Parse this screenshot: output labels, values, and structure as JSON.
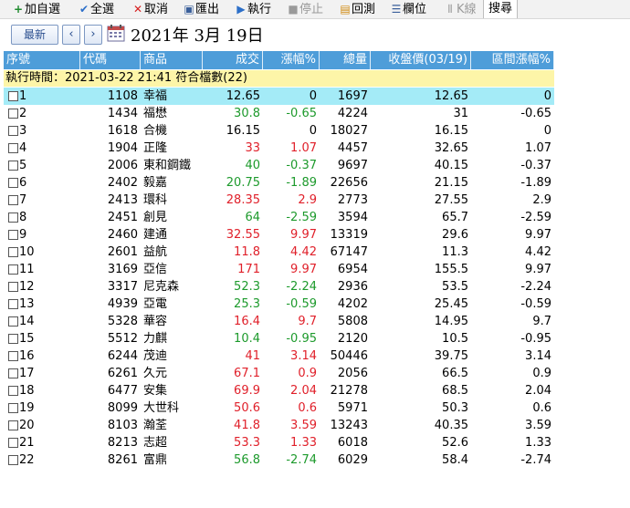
{
  "toolbar": {
    "add_watch": "加自選",
    "select_all": "全選",
    "cancel": "取消",
    "export": "匯出",
    "run": "執行",
    "stop": "停止",
    "backtest": "回測",
    "columns": "欄位",
    "kline": "K線",
    "search": "搜尋"
  },
  "daterow": {
    "latest": "最新",
    "date": "2021年  3月 19日"
  },
  "columns": [
    "序號",
    "代碼",
    "商品",
    "成交",
    "漲幅%",
    "總量",
    "收盤價(03/19)",
    "區間漲幅%"
  ],
  "info": "執行時間：2021-03-22 21:41 符合檔數(22)",
  "rows": [
    {
      "no": "1",
      "code": "1108",
      "name": "幸福",
      "price": "12.65",
      "chg": "0",
      "vol": "1697",
      "close": "12.65",
      "range": "0",
      "dir": "flat"
    },
    {
      "no": "2",
      "code": "1434",
      "name": "福懋",
      "price": "30.8",
      "chg": "-0.65",
      "vol": "4224",
      "close": "31",
      "range": "-0.65",
      "dir": "down"
    },
    {
      "no": "3",
      "code": "1618",
      "name": "合機",
      "price": "16.15",
      "chg": "0",
      "vol": "18027",
      "close": "16.15",
      "range": "0",
      "dir": "flat"
    },
    {
      "no": "4",
      "code": "1904",
      "name": "正隆",
      "price": "33",
      "chg": "1.07",
      "vol": "4457",
      "close": "32.65",
      "range": "1.07",
      "dir": "up"
    },
    {
      "no": "5",
      "code": "2006",
      "name": "東和鋼鐵",
      "price": "40",
      "chg": "-0.37",
      "vol": "9697",
      "close": "40.15",
      "range": "-0.37",
      "dir": "down"
    },
    {
      "no": "6",
      "code": "2402",
      "name": "毅嘉",
      "price": "20.75",
      "chg": "-1.89",
      "vol": "22656",
      "close": "21.15",
      "range": "-1.89",
      "dir": "down"
    },
    {
      "no": "7",
      "code": "2413",
      "name": "環科",
      "price": "28.35",
      "chg": "2.9",
      "vol": "2773",
      "close": "27.55",
      "range": "2.9",
      "dir": "up"
    },
    {
      "no": "8",
      "code": "2451",
      "name": "創見",
      "price": "64",
      "chg": "-2.59",
      "vol": "3594",
      "close": "65.7",
      "range": "-2.59",
      "dir": "down"
    },
    {
      "no": "9",
      "code": "2460",
      "name": "建通",
      "price": "32.55",
      "chg": "9.97",
      "vol": "13319",
      "close": "29.6",
      "range": "9.97",
      "dir": "up"
    },
    {
      "no": "10",
      "code": "2601",
      "name": "益航",
      "price": "11.8",
      "chg": "4.42",
      "vol": "67147",
      "close": "11.3",
      "range": "4.42",
      "dir": "up"
    },
    {
      "no": "11",
      "code": "3169",
      "name": "亞信",
      "price": "171",
      "chg": "9.97",
      "vol": "6954",
      "close": "155.5",
      "range": "9.97",
      "dir": "up"
    },
    {
      "no": "12",
      "code": "3317",
      "name": "尼克森",
      "price": "52.3",
      "chg": "-2.24",
      "vol": "2936",
      "close": "53.5",
      "range": "-2.24",
      "dir": "down"
    },
    {
      "no": "13",
      "code": "4939",
      "name": "亞電",
      "price": "25.3",
      "chg": "-0.59",
      "vol": "4202",
      "close": "25.45",
      "range": "-0.59",
      "dir": "down"
    },
    {
      "no": "14",
      "code": "5328",
      "name": "華容",
      "price": "16.4",
      "chg": "9.7",
      "vol": "5808",
      "close": "14.95",
      "range": "9.7",
      "dir": "up"
    },
    {
      "no": "15",
      "code": "5512",
      "name": "力麒",
      "price": "10.4",
      "chg": "-0.95",
      "vol": "2120",
      "close": "10.5",
      "range": "-0.95",
      "dir": "down"
    },
    {
      "no": "16",
      "code": "6244",
      "name": "茂迪",
      "price": "41",
      "chg": "3.14",
      "vol": "50446",
      "close": "39.75",
      "range": "3.14",
      "dir": "up"
    },
    {
      "no": "17",
      "code": "6261",
      "name": "久元",
      "price": "67.1",
      "chg": "0.9",
      "vol": "2056",
      "close": "66.5",
      "range": "0.9",
      "dir": "up"
    },
    {
      "no": "18",
      "code": "6477",
      "name": "安集",
      "price": "69.9",
      "chg": "2.04",
      "vol": "21278",
      "close": "68.5",
      "range": "2.04",
      "dir": "up"
    },
    {
      "no": "19",
      "code": "8099",
      "name": "大世科",
      "price": "50.6",
      "chg": "0.6",
      "vol": "5971",
      "close": "50.3",
      "range": "0.6",
      "dir": "up"
    },
    {
      "no": "20",
      "code": "8103",
      "name": "瀚荃",
      "price": "41.8",
      "chg": "3.59",
      "vol": "13243",
      "close": "40.35",
      "range": "3.59",
      "dir": "up"
    },
    {
      "no": "21",
      "code": "8213",
      "name": "志超",
      "price": "53.3",
      "chg": "1.33",
      "vol": "6018",
      "close": "52.6",
      "range": "1.33",
      "dir": "up"
    },
    {
      "no": "22",
      "code": "8261",
      "name": "富鼎",
      "price": "56.8",
      "chg": "-2.74",
      "vol": "6029",
      "close": "58.4",
      "range": "-2.74",
      "dir": "down"
    }
  ],
  "colors": {
    "up": "#e0202a",
    "down": "#1d9a2c",
    "header": "#4e9dd9",
    "info": "#fdf5a8",
    "selected": "#a4ebf7"
  }
}
